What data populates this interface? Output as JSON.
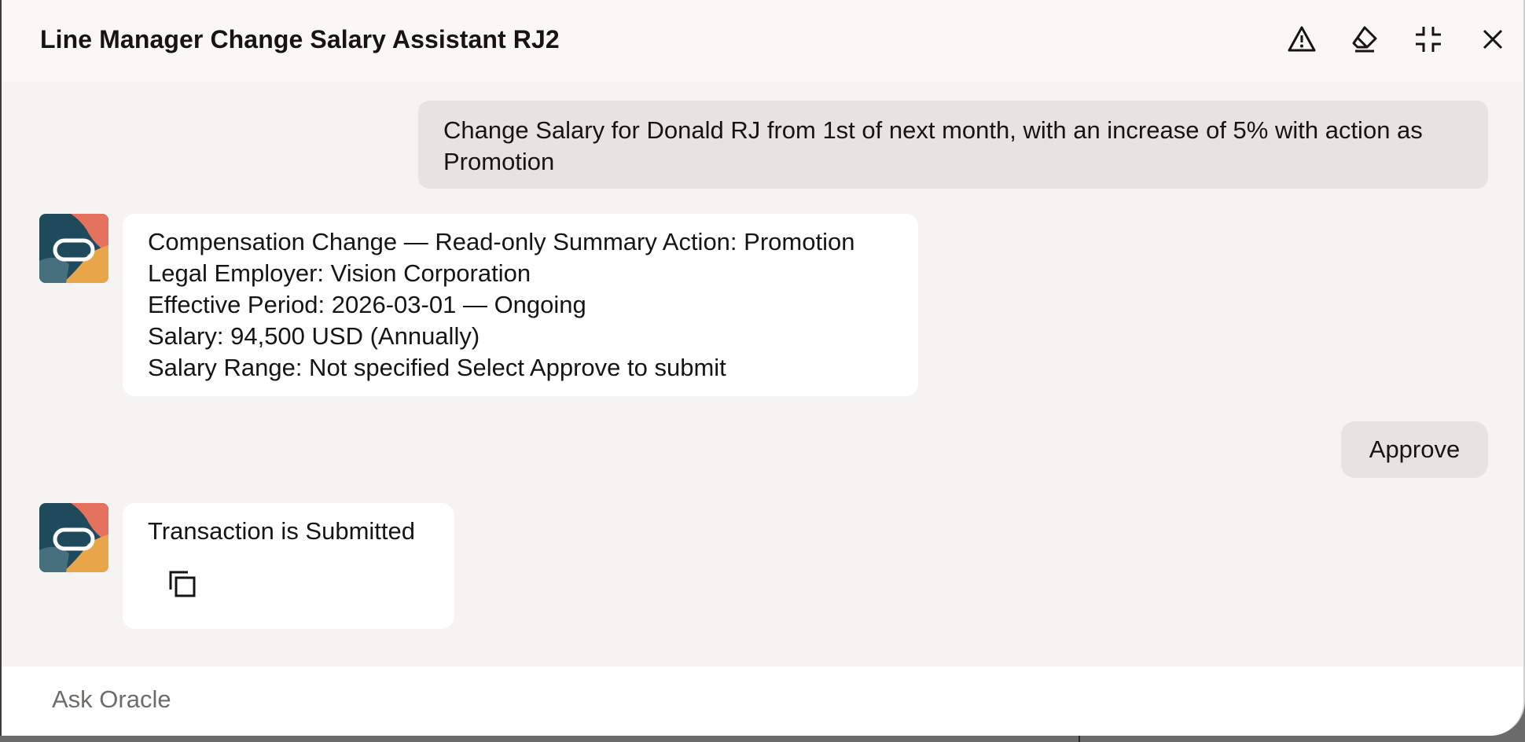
{
  "header": {
    "title": "Line Manager Change Salary Assistant RJ2",
    "icons": [
      "warning-icon",
      "eraser-icon",
      "collapse-icon",
      "close-icon"
    ]
  },
  "conversation": {
    "user_message": "Change Salary for Donald RJ from 1st of next month, with an increase of 5% with action as Promotion",
    "summary_lines": [
      "Compensation Change — Read-only Summary Action: Promotion",
      "Legal Employer: Vision Corporation",
      "Effective Period: 2026-03-01 — Ongoing",
      "Salary: 94,500 USD (Annually)",
      "Salary Range: Not specified Select Approve to submit"
    ],
    "approve_label": "Approve",
    "result_message": "Transaction is Submitted"
  },
  "input": {
    "placeholder": "Ask Oracle",
    "value": ""
  },
  "colors": {
    "panel_bg": "#f5f4f2",
    "user_bubble": "#e6e3e0",
    "bot_bubble": "#ffffff",
    "text": "#161513"
  }
}
